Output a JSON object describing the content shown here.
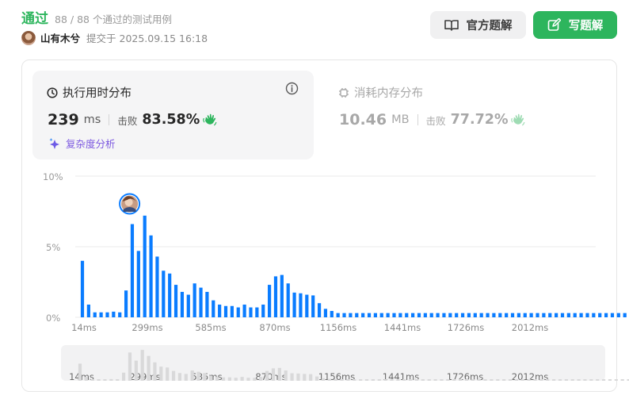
{
  "header": {
    "status": "通过",
    "testcases": "88 / 88 个通过的测试用例",
    "author": "山有木兮",
    "submitted": "提交于 2025.09.15 16:18"
  },
  "buttons": {
    "official_solution": "官方题解",
    "write_solution": "写题解"
  },
  "runtime": {
    "title": "执行用时分布",
    "value": "239",
    "unit": "ms",
    "beat_label": "击败",
    "beat_pct": "83.58%",
    "complexity_link": "复杂度分析"
  },
  "memory": {
    "title": "消耗内存分布",
    "value": "10.46",
    "unit": "MB",
    "beat_label": "击败",
    "beat_pct": "77.72%"
  },
  "colors": {
    "accent_green": "#2db55d",
    "bar_blue": "#0a7cff",
    "purple": "#7b57e0"
  },
  "chart_data": {
    "type": "bar",
    "ylabels": [
      "10%",
      "5%",
      "0%"
    ],
    "ylim": [
      0,
      10
    ],
    "xlabels": [
      "14ms",
      "299ms",
      "585ms",
      "870ms",
      "1156ms",
      "1441ms",
      "1726ms",
      "2012ms"
    ],
    "highlight_index": 7,
    "values": [
      4.0,
      0.9,
      0.35,
      0.35,
      0.35,
      0.4,
      0.35,
      1.9,
      6.6,
      4.7,
      7.2,
      5.8,
      4.3,
      3.3,
      3.1,
      2.3,
      1.8,
      1.6,
      2.4,
      2.1,
      1.8,
      1.2,
      0.9,
      0.8,
      0.8,
      0.7,
      0.9,
      0.7,
      0.7,
      0.9,
      2.3,
      2.9,
      3.0,
      2.4,
      1.75,
      1.7,
      1.6,
      1.55,
      1.0,
      0.6,
      0.45,
      0.3,
      0.3,
      0.3,
      0.3,
      0.3,
      0.3,
      0.3,
      0.3,
      0.3,
      0.3,
      0.3,
      0.3,
      0.3,
      0.3,
      0.3,
      0.3,
      0.3,
      0.3,
      0.3,
      0.3,
      0.3,
      0.3,
      0.3,
      0.3,
      0.3,
      0.3,
      0.3,
      0.3,
      0.3,
      0.3,
      0.3,
      0.3,
      0.3,
      0.3,
      0.3,
      0.3,
      0.3,
      0.3,
      0.3,
      0.3,
      0.3,
      0.3,
      0.3,
      0.3,
      0.3,
      0.3,
      0.3,
      0.3,
      0.3,
      0.3,
      0.3,
      0.3,
      0.3,
      0.3,
      0.3,
      0.3,
      0.3,
      0.3,
      0.3,
      0.3,
      0.3,
      0.3,
      0.3,
      0.3,
      0.3,
      0.3,
      0.3,
      0.3,
      0.3,
      0.3,
      0.3,
      0.3,
      0.3,
      0.3,
      0.3,
      0.3,
      0.3,
      0.3,
      0.3,
      0.3,
      0.3,
      0.3,
      0.3,
      0.3,
      0.3,
      0.3,
      0.3,
      0.3,
      0.3,
      0.3,
      0.3,
      0.3,
      0.3,
      0.3,
      0.3,
      0.3,
      0.3,
      0.3,
      1.2,
      0.95,
      0.4,
      0.35,
      0.65,
      1.1,
      1.25
    ]
  }
}
